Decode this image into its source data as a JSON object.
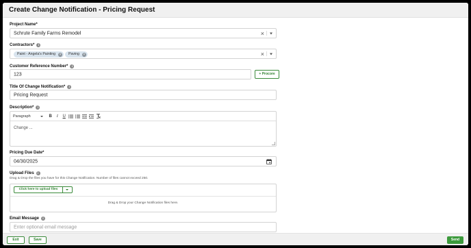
{
  "header": {
    "title": "Create Change Notification - Pricing Request"
  },
  "project": {
    "label": "Project Name*",
    "value": "Schrute Family Farms Remodel"
  },
  "contractors": {
    "label": "Contractors*",
    "chips": [
      "Paint - Angela's Painting",
      "Paving"
    ]
  },
  "customer_ref": {
    "label": "Customer Reference Number*",
    "value": "123",
    "procore_label": "+ Procore"
  },
  "title_field": {
    "label": "Title Of Change Notification*",
    "value": "Pricing Request"
  },
  "description": {
    "label": "Description*",
    "format": "Paragraph",
    "value": "Change ..."
  },
  "due_date": {
    "label": "Pricing Due Date*",
    "value": "04/30/2025"
  },
  "upload": {
    "label": "Upload Files",
    "helper": "Drag & Drop the files you have for this Change Notification. Number of files cannot exceed 250.",
    "button": "Click here to upload files",
    "drop_text": "Drag & Drop your Change Notification files here."
  },
  "email": {
    "label": "Email Message",
    "placeholder": "Enter optional email message"
  },
  "footer": {
    "exit": "Exit",
    "save": "Save",
    "send": "Send"
  },
  "colors": {
    "accent": "#2d7f2d",
    "send_bg": "#3c9a3c",
    "chip_bg": "#d9e4ee"
  },
  "icons": {
    "info": "info-icon",
    "clear": "close-icon",
    "dropdown": "chevron-down-icon",
    "calendar": "calendar-icon"
  }
}
